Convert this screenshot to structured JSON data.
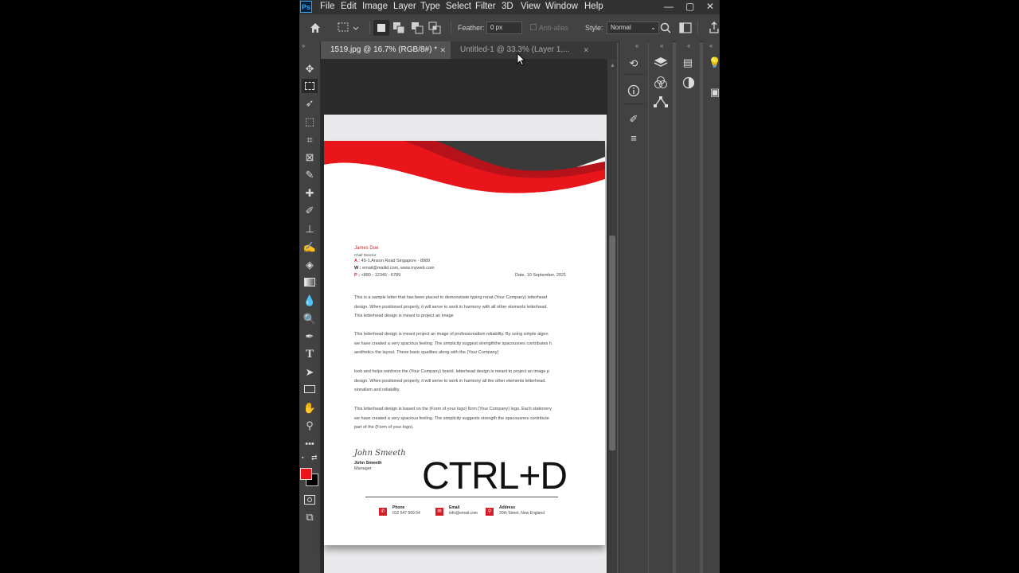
{
  "app": {
    "logo": "Ps",
    "menu": [
      "File",
      "Edit",
      "Image",
      "Layer",
      "Type",
      "Select",
      "Filter",
      "3D",
      "View",
      "Window",
      "Help"
    ],
    "window_controls": [
      "—",
      "▢",
      "✕"
    ]
  },
  "options": {
    "feather_label": "Feather:",
    "feather_value": "0 px",
    "antialias_label": "Anti-alias",
    "style_label": "Style:",
    "style_value": "Normal"
  },
  "tabs": [
    {
      "label": "1519.jpg @ 16.7% (RGB/8#) *",
      "active": true
    },
    {
      "label": "Untitled-1 @ 33.3% (Layer 1,...",
      "active": false
    }
  ],
  "tools": [
    "move-tool",
    "marquee-tool",
    "lasso-tool",
    "object-select-tool",
    "crop-tool",
    "frame-tool",
    "eyedropper-tool",
    "healing-tool",
    "brush-tool",
    "stamp-tool",
    "history-brush-tool",
    "eraser-tool",
    "gradient-tool",
    "blur-tool",
    "dodge-tool",
    "pen-tool",
    "type-tool",
    "path-select-tool",
    "rectangle-tool",
    "hand-tool",
    "zoom-tool",
    "more-tools"
  ],
  "colors": {
    "foreground": "#e8151b",
    "background": "#000000",
    "accent": "#d71e28"
  },
  "letter": {
    "name": "James Doe",
    "title": "Chief Director",
    "address_label": "A :",
    "address": "45-1,Anson Road Singapore - 8989",
    "web_label": "W :",
    "web": "email@mailid.com, www.myweb.com",
    "phone_label": "P :",
    "phone": "+880 - 12345 - 6789",
    "date": "Date, 10 September, 2021",
    "p1": [
      "This is a sample letter that has been placed to demonstrate typing renat (Your Company) letterhead",
      "design. When positioned properly, it will serve to work in harmony with all other elements letterhead.",
      "This letterhead design is meant to project an image"
    ],
    "p2": [
      "This letterhead design is meant project an image of professionalism reliability. By using simple algen",
      "we have created a very spacious feeling. The simplicity suggest strengththe spacousnes contributes h",
      "aesthetics the layout. These basic qualities along with the (Your Company)"
    ],
    "p3": [
      "look and helps reinforce the (Your Company) brand. letterhead design is meant to project an image p",
      "design. When positioned properly, it will serve to work in harmony all the other elements letterhead.",
      "sionalism and reliability."
    ],
    "p4": [
      "This letterhead design is based on the (Form of your logo) form (Your Company) logo. Each stationery",
      "we have created a very spacious feeling. The simplicity suggests strength the spacousnes contribute",
      "part of the (Form of your logo)."
    ],
    "signature": "John Smeeth",
    "signer_name": "John Smeeth",
    "signer_role": "Manager",
    "footer": [
      {
        "label": "Phone",
        "value": "012 547 569 54"
      },
      {
        "label": "Email",
        "value": "info@email.com"
      },
      {
        "label": "Address",
        "value": "20th Street, New England"
      }
    ]
  },
  "overlay_text": "CTRL+D"
}
